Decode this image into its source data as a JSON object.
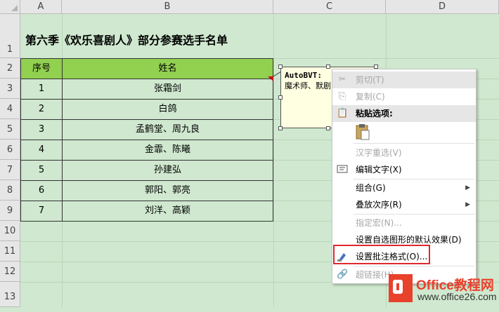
{
  "columns": [
    "A",
    "B",
    "C",
    "D"
  ],
  "rows": [
    "1",
    "2",
    "3",
    "4",
    "5",
    "6",
    "7",
    "8",
    "9",
    "10",
    "11",
    "12",
    "13"
  ],
  "title": "第六季《欢乐喜剧人》部分参赛选手名单",
  "table": {
    "headers": [
      "序号",
      "姓名"
    ],
    "rows": [
      [
        "1",
        "张霜剑"
      ],
      [
        "2",
        "白鸽"
      ],
      [
        "3",
        "孟鹤堂、周九良"
      ],
      [
        "4",
        "金霏、陈曦"
      ],
      [
        "5",
        "孙建弘"
      ],
      [
        "6",
        "郭阳、郭亮"
      ],
      [
        "7",
        "刘洋、高颖"
      ]
    ]
  },
  "comment": {
    "author": "AutoBVT:",
    "text": "魔术师、默剧"
  },
  "context_menu": {
    "items": [
      {
        "label": "剪切(T)",
        "icon": "scissors-icon",
        "disabled": true
      },
      {
        "label": "复制(C)",
        "icon": "copy-icon",
        "disabled": true
      },
      {
        "label": "粘贴选项:",
        "icon": "paste-icon",
        "disabled": false
      },
      {
        "label": "汉字重选(V)",
        "icon": "",
        "disabled": true
      },
      {
        "label": "编辑文字(X)",
        "icon": "edit-text-icon",
        "disabled": false
      },
      {
        "label": "组合(G)",
        "icon": "",
        "disabled": false
      },
      {
        "label": "叠放次序(R)",
        "icon": "",
        "disabled": false
      },
      {
        "label": "指定宏(N)...",
        "icon": "",
        "disabled": true
      },
      {
        "label": "设置自选图形的默认效果(D)",
        "icon": "",
        "disabled": false
      },
      {
        "label": "设置批注格式(O)...",
        "icon": "format-comment-icon",
        "disabled": false
      },
      {
        "label": "超链接(H)...",
        "icon": "hyperlink-icon",
        "disabled": true
      }
    ]
  },
  "watermark": {
    "line1": "Office教程网",
    "line2": "www.office26.com",
    "brand_color": "#e8412c"
  }
}
